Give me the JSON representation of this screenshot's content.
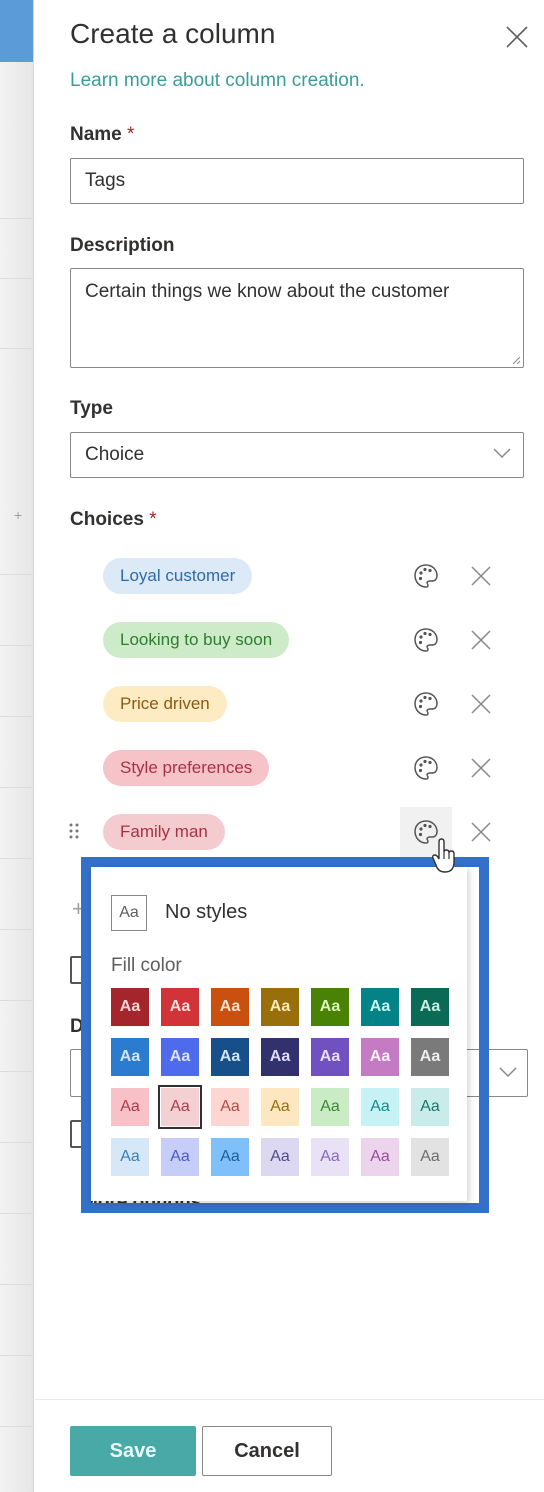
{
  "panel": {
    "title": "Create a column",
    "learn_more": "Learn more about column creation.",
    "required_marker": "*"
  },
  "name_field": {
    "label": "Name",
    "value": "Tags"
  },
  "description_field": {
    "label": "Description",
    "value": "Certain things we know about the customer"
  },
  "type_field": {
    "label": "Type",
    "value": "Choice"
  },
  "choices": {
    "label": "Choices",
    "items": [
      {
        "label": "Loyal customer",
        "bg": "#dce9f7",
        "fg": "#2f6aa8"
      },
      {
        "label": "Looking to buy soon",
        "bg": "#cdebc9",
        "fg": "#2f7d2f"
      },
      {
        "label": "Price driven",
        "bg": "#fdebc4",
        "fg": "#8a5a10"
      },
      {
        "label": "Style preferences",
        "bg": "#f6c3c9",
        "fg": "#a83241"
      },
      {
        "label": "Family man",
        "bg": "#f4cccf",
        "fg": "#a83241"
      }
    ]
  },
  "hidden_behind": {
    "default_label_partial": "D",
    "more_options": "More options"
  },
  "style_popup": {
    "no_styles_swatch": "Aa",
    "no_styles_label": "No styles",
    "fill_color_label": "Fill color",
    "swatch_text": "Aa",
    "selected_index": 15,
    "rows": [
      [
        {
          "bg": "#a4262c",
          "fg": "#ffd6d6"
        },
        {
          "bg": "#d13438",
          "fg": "#ffdede"
        },
        {
          "bg": "#ca5010",
          "fg": "#ffe3cf"
        },
        {
          "bg": "#986f0b",
          "fg": "#ffeab8"
        },
        {
          "bg": "#498205",
          "fg": "#d9f7b8"
        },
        {
          "bg": "#038387",
          "fg": "#c8f6f7"
        },
        {
          "bg": "#0b6a56",
          "fg": "#c6efe3"
        }
      ],
      [
        {
          "bg": "#2b7bd1",
          "fg": "#cfe8ff"
        },
        {
          "bg": "#4f6bed",
          "fg": "#dde3ff"
        },
        {
          "bg": "#174f8a",
          "fg": "#d0e4fa"
        },
        {
          "bg": "#32316e",
          "fg": "#dcdaff"
        },
        {
          "bg": "#7150c0",
          "fg": "#eadfff"
        },
        {
          "bg": "#c57ac4",
          "fg": "#fff0ff"
        },
        {
          "bg": "#7a7a7a",
          "fg": "#eeeeee"
        }
      ],
      [
        {
          "bg": "#f8c1c8",
          "fg": "#b13a49"
        },
        {
          "bg": "#f3d0d2",
          "fg": "#b13a49"
        },
        {
          "bg": "#fdd6d2",
          "fg": "#b44e3d"
        },
        {
          "bg": "#fde7c0",
          "fg": "#9a6b12"
        },
        {
          "bg": "#c9ecc5",
          "fg": "#3a8a32"
        },
        {
          "bg": "#c6f2f6",
          "fg": "#168a90"
        },
        {
          "bg": "#c9eceb",
          "fg": "#137a6b"
        }
      ],
      [
        {
          "bg": "#d6e7f7",
          "fg": "#3a7fb5"
        },
        {
          "bg": "#c6cdf8",
          "fg": "#4a5bc8"
        },
        {
          "bg": "#7fc0fa",
          "fg": "#1d5f9a"
        },
        {
          "bg": "#dcd8f1",
          "fg": "#4d4b8a"
        },
        {
          "bg": "#e9e2f5",
          "fg": "#8a66c2"
        },
        {
          "bg": "#ecd4ec",
          "fg": "#9a4c9a"
        },
        {
          "bg": "#e2e2e2",
          "fg": "#6e6e6e"
        }
      ]
    ]
  },
  "footer": {
    "save": "Save",
    "cancel": "Cancel"
  },
  "colors": {
    "accent": "#48a9a6",
    "link": "#3a9d99",
    "highlight_frame": "#3370c8"
  }
}
